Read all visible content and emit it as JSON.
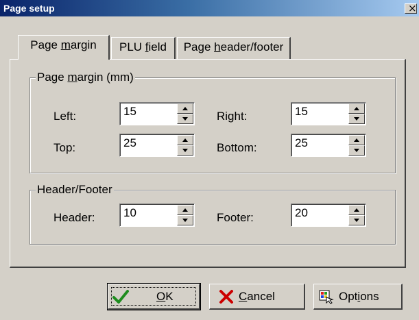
{
  "window": {
    "title": "Page setup",
    "close_glyph": "×"
  },
  "tabs": [
    {
      "pre": "Page ",
      "key": "m",
      "post": "argin",
      "active": true
    },
    {
      "pre": "PLU ",
      "key": "f",
      "post": "ield",
      "active": false
    },
    {
      "pre": "Page ",
      "key": "h",
      "post": "eader/footer",
      "active": false
    }
  ],
  "page_margin": {
    "legend_pre": "Page ",
    "legend_key": "m",
    "legend_post": "argin (mm)",
    "left_label": "Left:",
    "left_value": "15",
    "right_label": "Right:",
    "right_value": "15",
    "top_label": "Top:",
    "top_value": "25",
    "bottom_label": "Bottom:",
    "bottom_value": "25"
  },
  "header_footer": {
    "legend": "Header/Footer",
    "header_label": "Header:",
    "header_value": "10",
    "footer_label": "Footer:",
    "footer_value": "20"
  },
  "buttons": {
    "ok": {
      "key": "O",
      "post": "K",
      "icon": "checkmark-icon",
      "color": "#1e8c1e"
    },
    "cancel": {
      "key": "C",
      "post": "ancel",
      "icon": "x-icon",
      "color": "#cc0000"
    },
    "options": {
      "pre": "Opt",
      "key": "i",
      "post": "ons",
      "icon": "options-icon"
    }
  }
}
